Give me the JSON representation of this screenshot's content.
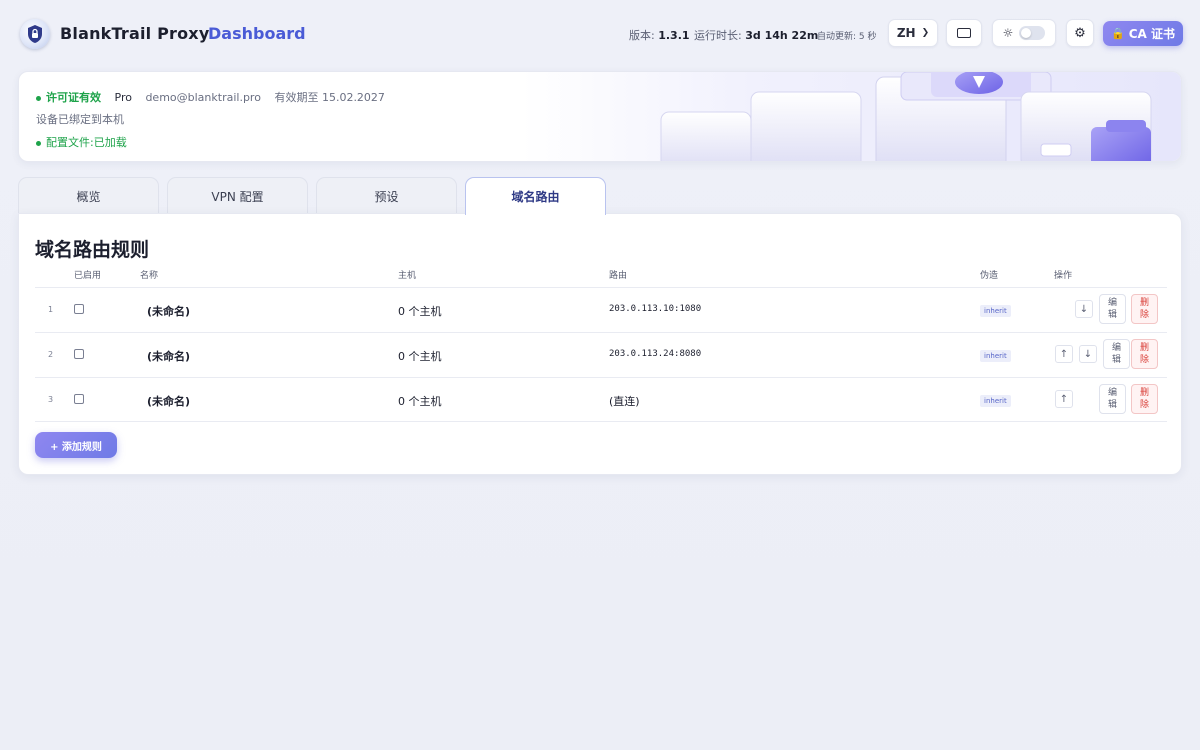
{
  "header": {
    "brand": "BlankTrail Proxy",
    "brand_sub": "Dashboard",
    "version_label": "版本:",
    "version": "1.3.1",
    "uptime_label": "运行时长:",
    "uptime": "3d 14h 22m",
    "auto_refresh": "自动更新: 5 秒",
    "language": "ZH",
    "ca_button": "CA 证书"
  },
  "license": {
    "status": "许可证有效",
    "plan": "Pro",
    "email": "demo@blanktrail.pro",
    "expires": "有效期至 15.02.2027",
    "device": "设备已绑定到本机",
    "config": "配置文件:已加载"
  },
  "tabs": [
    {
      "label": "概览"
    },
    {
      "label": "VPN 配置"
    },
    {
      "label": "预设"
    },
    {
      "label": "域名路由"
    }
  ],
  "active_tab": "域名路由",
  "section": {
    "title": "域名路由规则",
    "columns": {
      "enabled": "已启用",
      "name": "名称",
      "hosts": "主机",
      "route": "路由",
      "masquerade": "伪造",
      "actions": "操作"
    },
    "rows": [
      {
        "index": "1",
        "enabled": false,
        "name": "(未命名)",
        "hosts": "0 个主机",
        "route": "203.0.113.10:1080",
        "masquerade": "inherit"
      },
      {
        "index": "2",
        "enabled": false,
        "name": "(未命名)",
        "hosts": "0 个主机",
        "route": "203.0.113.24:8080",
        "masquerade": "inherit"
      },
      {
        "index": "3",
        "enabled": false,
        "name": "(未命名)",
        "hosts": "0 个主机",
        "route": "(直连)",
        "masquerade": "inherit"
      }
    ],
    "move_up": "↑",
    "move_down": "↓",
    "edit_label": "编辑",
    "delete_label": "删除",
    "add_button": "+ 添加规则"
  },
  "colors": {
    "accent": "#6f7ae6",
    "success": "#1ea34a",
    "danger": "#d9403a"
  }
}
